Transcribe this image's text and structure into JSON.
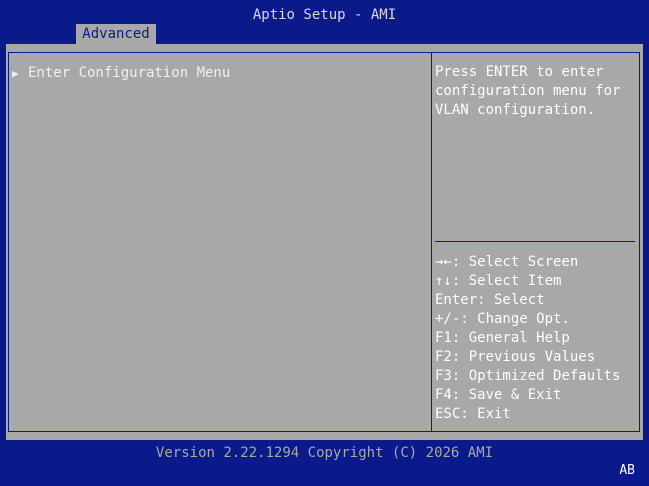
{
  "title": "Aptio Setup - AMI",
  "tabs": [
    {
      "label": "Advanced",
      "active": true
    }
  ],
  "menu": [
    {
      "label": "Enter Configuration Menu",
      "submenu": true
    }
  ],
  "help_text": "Press ENTER to enter configuration menu for VLAN configuration.",
  "key_legend": [
    "→←: Select Screen",
    "↑↓: Select Item",
    "Enter: Select",
    "+/-: Change Opt.",
    "F1: General Help",
    "F2: Previous Values",
    "F3: Optimized Defaults",
    "F4: Save & Exit",
    "ESC: Exit"
  ],
  "footer": "Version 2.22.1294 Copyright (C) 2026 AMI",
  "status_badge": "AB",
  "colors": {
    "frame": "#0a1a8a",
    "panel": "#a8a8a8",
    "text": "#ffffff"
  }
}
